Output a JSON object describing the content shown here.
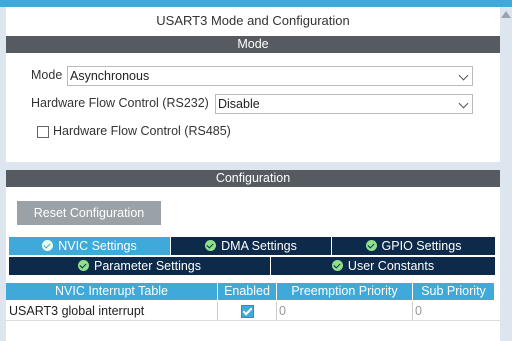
{
  "window": {
    "title": "USART3 Mode and Configuration"
  },
  "mode_section": {
    "header": "Mode",
    "mode_label": "Mode",
    "mode_value": "Asynchronous",
    "hw_flow_rs232_label": "Hardware Flow Control (RS232)",
    "hw_flow_rs232_value": "Disable",
    "hw_flow_rs485_label": "Hardware Flow Control (RS485)",
    "hw_flow_rs485_checked": false
  },
  "config_section": {
    "header": "Configuration",
    "reset_button": "Reset Configuration",
    "tabs": [
      {
        "label": "NVIC Settings",
        "active": true
      },
      {
        "label": "DMA Settings",
        "active": false
      },
      {
        "label": "GPIO Settings",
        "active": false
      },
      {
        "label": "Parameter Settings",
        "active": false
      },
      {
        "label": "User Constants",
        "active": false
      }
    ],
    "table": {
      "columns": [
        "NVIC Interrupt Table",
        "Enabled",
        "Preemption Priority",
        "Sub Priority"
      ],
      "rows": [
        {
          "name": "USART3 global interrupt",
          "enabled": true,
          "preemption": "0",
          "sub": "0"
        }
      ]
    }
  },
  "colors": {
    "accent": "#3fa9d9",
    "tab_dark": "#0d2a4a",
    "section_bar": "#555b61",
    "button": "#9aa1a7"
  }
}
